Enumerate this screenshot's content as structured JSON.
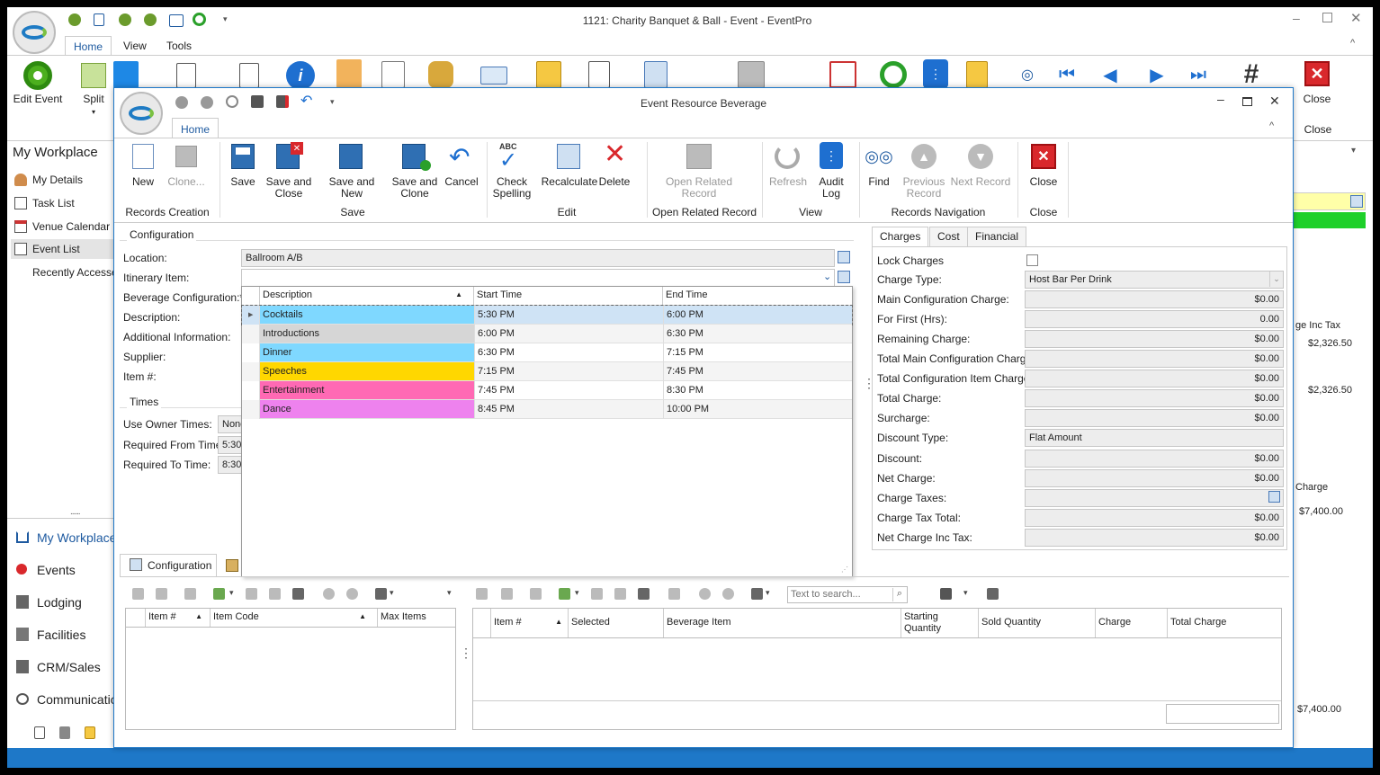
{
  "main_window": {
    "title": "1121: Charity Banquet & Ball - Event - EventPro",
    "tabs": [
      "Home",
      "View",
      "Tools"
    ],
    "edit_event": "Edit Event",
    "split": "Split",
    "close": "Close",
    "close_group": "Close"
  },
  "sidebar": {
    "title": "My Workplace",
    "items": [
      "My Details",
      "Task List",
      "Venue Calendar",
      "Event List",
      "Recently Accessed"
    ],
    "grip": "......",
    "modules": [
      "My Workplace",
      "Events",
      "Lodging",
      "Facilities",
      "CRM/Sales",
      "Communicatio"
    ]
  },
  "bg_right": {
    "col1": "ge Inc Tax",
    "v1": "$2,326.50",
    "v2": "$2,326.50",
    "col2": "Charge",
    "v3": "$7,400.00",
    "v4": "$7,400.00"
  },
  "dialog": {
    "title": "Event Resource Beverage",
    "tab": "Home",
    "ribbon": {
      "new": "New",
      "clone": "Clone...",
      "save": "Save",
      "save_close": "Save and Close",
      "save_new": "Save and New",
      "save_clone": "Save and Clone",
      "cancel": "Cancel",
      "check_spelling": "Check Spelling",
      "recalculate": "Recalculate",
      "delete": "Delete",
      "open_related": "Open Related Record",
      "refresh": "Refresh",
      "audit_log": "Audit Log",
      "find": "Find",
      "previous": "Previous Record",
      "next": "Next Record",
      "close": "Close",
      "groups": {
        "records_creation": "Records Creation",
        "save": "Save",
        "edit": "Edit",
        "open_related": "Open Related Record",
        "view": "View",
        "navigation": "Records Navigation",
        "close": "Close"
      }
    },
    "configuration": {
      "legend": "Configuration",
      "location_label": "Location:",
      "location_value": "Ballroom A/B",
      "itinerary_label": "Itinerary Item:",
      "beverage_config_label": "Beverage Configuration:*",
      "description_label": "Description:",
      "additional_label": "Additional Information:",
      "supplier_label": "Supplier:",
      "item_no_label": "Item #:"
    },
    "times": {
      "legend": "Times",
      "use_owner_label": "Use Owner Times:",
      "use_owner_value": "None",
      "from_label": "Required From Time:",
      "from_value": "5:30",
      "to_label": "Required To Time:",
      "to_value": "8:30"
    },
    "dropdown": {
      "headers": [
        "Description",
        "Start Time",
        "End Time"
      ],
      "rows": [
        {
          "description": "Cocktails",
          "start": "5:30 PM",
          "end": "6:00 PM",
          "color": "#7fd8ff"
        },
        {
          "description": "Introductions",
          "start": "6:00 PM",
          "end": "6:30 PM",
          "color": "#d6d6d6"
        },
        {
          "description": "Dinner",
          "start": "6:30 PM",
          "end": "7:15 PM",
          "color": "#7fd8ff"
        },
        {
          "description": "Speeches",
          "start": "7:15 PM",
          "end": "7:45 PM",
          "color": "#ffd700"
        },
        {
          "description": "Entertainment",
          "start": "7:45 PM",
          "end": "8:30 PM",
          "color": "#ff69b4"
        },
        {
          "description": "Dance",
          "start": "8:45 PM",
          "end": "10:00 PM",
          "color": "#ee82ee"
        }
      ]
    },
    "charges": {
      "tabs": [
        "Charges",
        "Cost",
        "Financial"
      ],
      "lock_label": "Lock Charges",
      "charge_type_label": "Charge Type:",
      "charge_type_value": "Host Bar Per Drink",
      "main_config_label": "Main Configuration Charge:",
      "main_config_value": "$0.00",
      "first_hrs_label": "For First (Hrs):",
      "first_hrs_value": "0.00",
      "remaining_label": "Remaining Charge:",
      "remaining_value": "$0.00",
      "total_main_label": "Total Main Configuration Charge:",
      "total_main_value": "$0.00",
      "total_item_label": "Total Configuration Item Charge:",
      "total_item_value": "$0.00",
      "total_label": "Total Charge:",
      "total_value": "$0.00",
      "surcharge_label": "Surcharge:",
      "surcharge_value": "$0.00",
      "discount_type_label": "Discount Type:",
      "discount_type_value": "Flat Amount",
      "discount_label": "Discount:",
      "discount_value": "$0.00",
      "net_label": "Net Charge:",
      "net_value": "$0.00",
      "taxes_label": "Charge Taxes:",
      "tax_total_label": "Charge Tax Total:",
      "tax_total_value": "$0.00",
      "net_inc_label": "Net Charge Inc Tax:",
      "net_inc_value": "$0.00"
    },
    "bottom": {
      "tab": "Configuration",
      "search_placeholder": "Text to search...",
      "left_headers": [
        "Item #",
        "Item Code",
        "Max Items"
      ],
      "right_headers": [
        "Item #",
        "Selected",
        "Beverage Item",
        "Starting Quantity",
        "Sold Quantity",
        "Charge",
        "Total Charge"
      ]
    }
  }
}
